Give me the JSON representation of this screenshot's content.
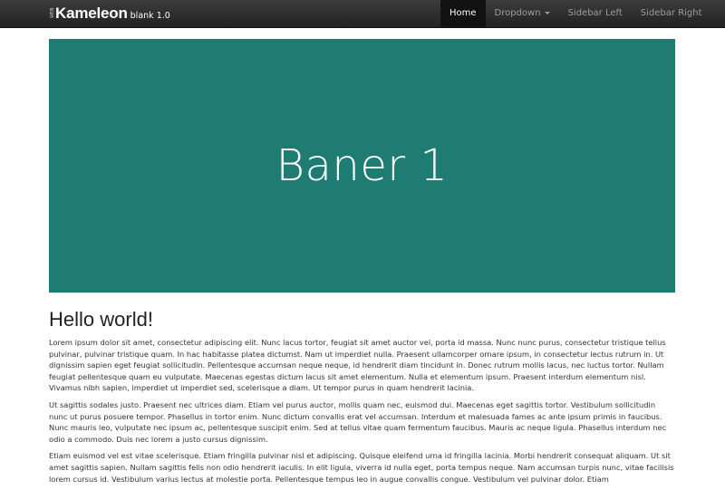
{
  "navbar": {
    "brand_prefix": "WEB",
    "brand_name": "Kameleon",
    "brand_version": "blank 1.0",
    "items": [
      {
        "label": "Home"
      },
      {
        "label": "Dropdown"
      },
      {
        "label": "Sidebar Left"
      },
      {
        "label": "Sidebar Right"
      }
    ]
  },
  "banner": {
    "title": "Baner 1",
    "background": "#1e7c72"
  },
  "content": {
    "heading": "Hello world!",
    "paragraphs": [
      "Lorem ipsum dolor sit amet, consectetur adipiscing elit. Nunc lacus tortor, feugiat sit amet auctor vel, porta id massa. Nunc nunc purus, consectetur tristique tellus pulvinar, pulvinar tristique quam. In hac habitasse platea dictumst. Nam ut imperdiet nulla. Praesent ullamcorper ornare ipsum, in consectetur lectus rutrum in. Ut dignissim sapien eget feugiat sollicitudin. Pellentesque accumsan neque neque, id hendrerit diam tincidunt in. Donec rutrum mollis lacus, nec luctus tortor. Nullam feugiat pellentesque quam eu vulputate. Maecenas egestas dictum lacus sit amet elementum. Nulla et elementum ipsum. Praesent interdum elementum nisl. Vivamus nibh sapien, imperdiet ut imperdiet sed, scelerisque a diam. Ut tempor purus in quam hendrerit lacinia.",
      "Ut sagittis sodales justo. Praesent nec ultrices diam. Etiam vel purus auctor, mollis quam nec, euismod dui. Maecenas eget sagittis tortor. Vestibulum sollicitudin nunc ut purus posuere tempor. Phasellus in tortor enim. Nunc dictum convallis erat vel accumsan. Interdum et malesuada fames ac ante ipsum primis in faucibus. Nunc mauris leo, vulputate nec ipsum ac, pellentesque suscipit enim. Sed at tellus vitae quam fermentum faucibus. Mauris ac neque ligula. Phasellus interdum nec odio a commodo. Duis nec lorem a justo cursus dignissim.",
      "Etiam euismod vel est vitae scelerisque. Etiam fringilla pulvinar nisl et adipiscing. Quisque eleifend urna id fringilla lacinia. Morbi hendrerit consequat aliquam. Ut sit amet sagittis sapien. Nullam sagittis felis non odio hendrerit iaculis. In elit ligula, viverra id nulla eget, porta tempus neque. Nam accumsan turpis nunc, vitae facilisis lorem cursus id. Vestibulum varius lectus at molestie porta. Pellentesque tempus leo in augue convallis congue. Vestibulum vel pulvinar dolor. Etiam"
    ]
  }
}
